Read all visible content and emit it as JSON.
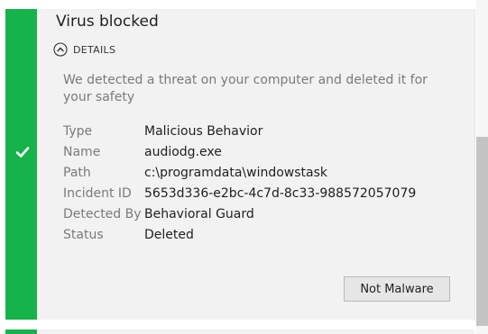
{
  "notification": {
    "title": "Virus blocked",
    "details_label": "DETAILS",
    "message": "We detected a threat on your computer and deleted it for your safety",
    "status_icon": "checkmark-icon",
    "toggle_icon": "chevron-up-circle-icon",
    "accent_color": "#16b24a",
    "fields": [
      {
        "key": "Type",
        "value": "Malicious Behavior"
      },
      {
        "key": "Name",
        "value": "audiodg.exe"
      },
      {
        "key": "Path",
        "value": "c:\\programdata\\windowstask"
      },
      {
        "key": "Incident ID",
        "value": "5653d336-e2bc-4c7d-8c33-988572057079"
      },
      {
        "key": "Detected By",
        "value": "Behavioral Guard"
      },
      {
        "key": "Status",
        "value": "Deleted"
      }
    ],
    "not_malware_label": "Not Malware"
  }
}
